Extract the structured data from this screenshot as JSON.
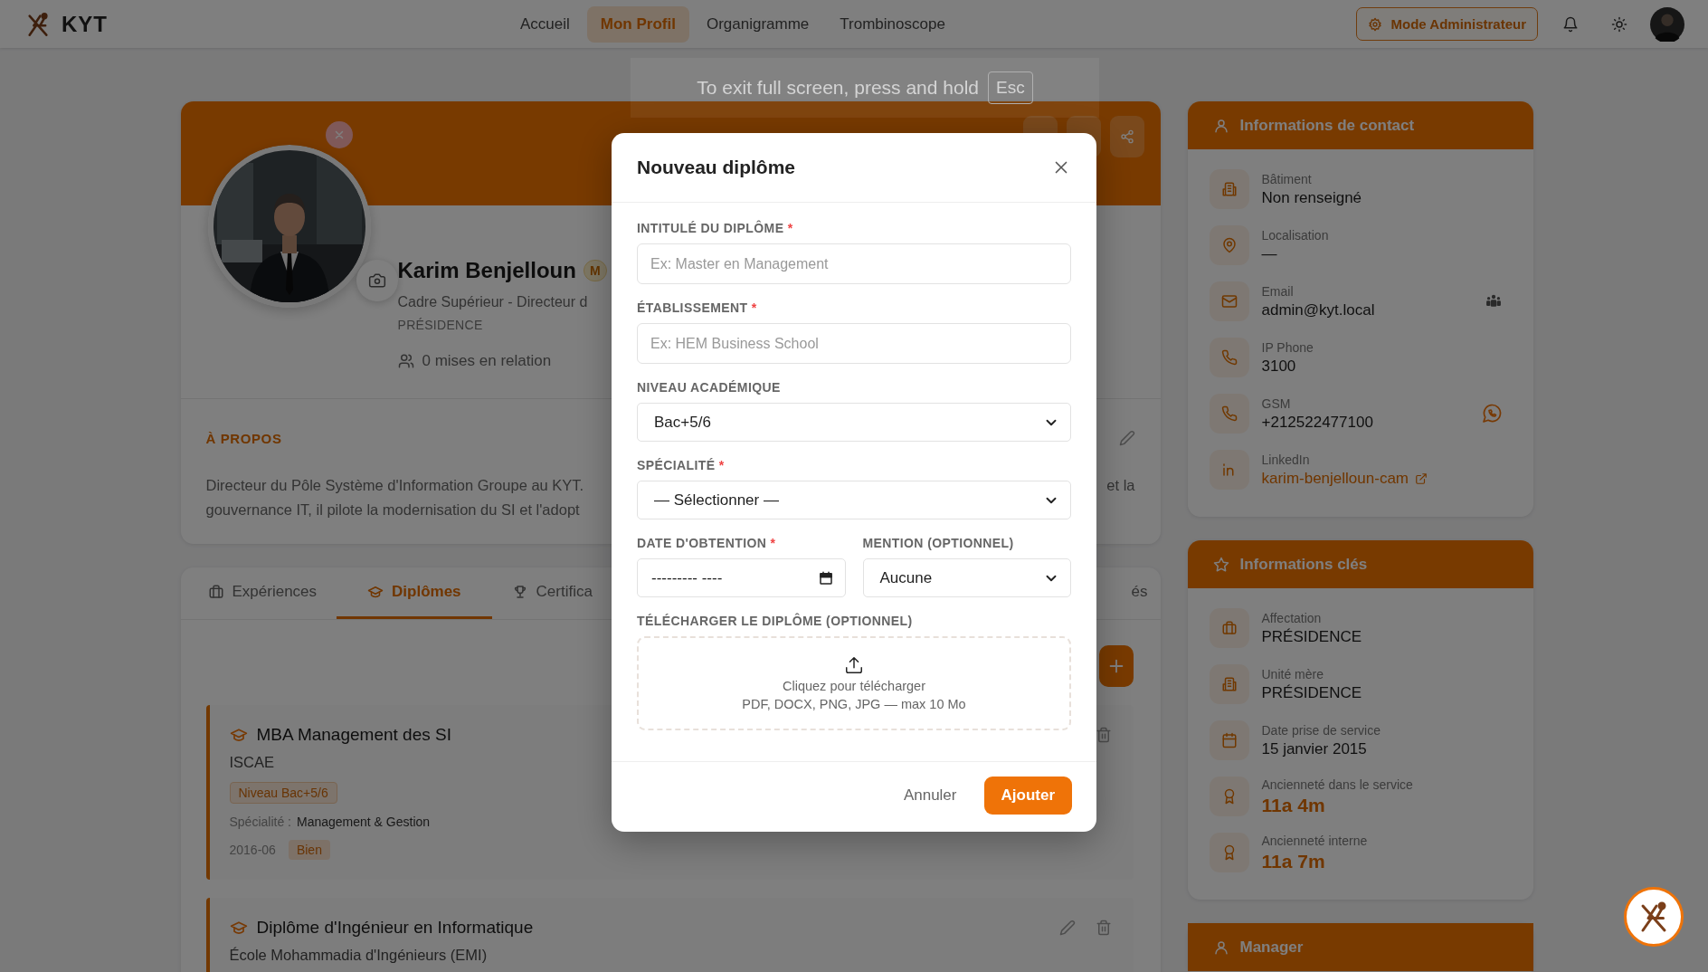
{
  "header": {
    "logo": "KYT",
    "nav": [
      {
        "label": "Accueil",
        "selected": false
      },
      {
        "label": "Mon Profil",
        "selected": true
      },
      {
        "label": "Organigramme",
        "selected": false
      },
      {
        "label": "Trombinoscope",
        "selected": false
      }
    ],
    "admin_button": "Mode Administrateur"
  },
  "fullscreen_notice": {
    "text": "To exit full screen, press and hold",
    "key": "Esc"
  },
  "profile": {
    "name": "Karim Benjelloun",
    "badge": "M",
    "title": "Cadre Supérieur - Directeur d",
    "unit": "PRÉSIDENCE",
    "connections": "0 mises en relation"
  },
  "about": {
    "heading": "À PROPOS",
    "lines": [
      "Directeur du Pôle Système d'Information Groupe au KYT.",
      "gouvernance IT, il pilote la modernisation du SI et l'adopt"
    ],
    "right_fragment": "et la"
  },
  "tabs": [
    {
      "label": "Expériences",
      "kind": "briefcase",
      "selected": false
    },
    {
      "label": "Diplômes",
      "kind": "cap",
      "selected": true
    },
    {
      "label": "Certifica",
      "kind": "trophy",
      "selected": false
    },
    {
      "label": "és",
      "kind": "none",
      "selected": false
    }
  ],
  "diplomas": [
    {
      "title": "MBA Management des SI",
      "school": "ISCAE",
      "level_tag": "Niveau Bac+5/6",
      "specialty_label": "Spécialité :",
      "specialty": "Management & Gestion",
      "date": "2016-06",
      "mention": "Bien"
    },
    {
      "title": "Diplôme d'Ingénieur en Informatique",
      "school": "École Mohammadia d'Ingénieurs (EMI)"
    }
  ],
  "contact": {
    "title": "Informations de contact",
    "rows": [
      {
        "kind": "building",
        "label": "Bâtiment",
        "value": "Non renseigné"
      },
      {
        "kind": "location",
        "label": "Localisation",
        "value": "—"
      },
      {
        "kind": "email",
        "label": "Email",
        "value": "admin@kyt.local"
      },
      {
        "kind": "phone",
        "label": "IP Phone",
        "value": "3100"
      },
      {
        "kind": "gsm",
        "label": "GSM",
        "value": "+212522477100"
      },
      {
        "kind": "linkedin",
        "label": "LinkedIn",
        "value": "karim-benjelloun-cam"
      }
    ]
  },
  "key_info": {
    "title": "Informations clés",
    "rows": [
      {
        "kind": "briefcase",
        "label": "Affectation",
        "value": "PRÉSIDENCE",
        "emphasis": false
      },
      {
        "kind": "building",
        "label": "Unité mère",
        "value": "PRÉSIDENCE",
        "emphasis": false
      },
      {
        "kind": "calendar",
        "label": "Date prise de service",
        "value": "15 janvier 2015",
        "emphasis": false
      },
      {
        "kind": "award",
        "label": "Ancienneté dans le service",
        "value": "11a 4m",
        "emphasis": true
      },
      {
        "kind": "award",
        "label": "Ancienneté interne",
        "value": "11a 7m",
        "emphasis": true
      }
    ]
  },
  "manager": {
    "title": "Manager"
  },
  "modal": {
    "title": "Nouveau diplôme",
    "fields": [
      {
        "kind": "text",
        "label": "INTITULÉ DU DIPLÔME",
        "required_mark": "*",
        "placeholder": "Ex: Master en Management"
      },
      {
        "kind": "text",
        "label": "ÉTABLISSEMENT",
        "required_mark": "*",
        "placeholder": "Ex: HEM Business School"
      },
      {
        "kind": "select",
        "label": "NIVEAU ACADÉMIQUE",
        "value": "Bac+5/6"
      },
      {
        "kind": "select",
        "label": "SPÉCIALITÉ",
        "required_mark": "*",
        "value": "— Sélectionner —"
      }
    ],
    "row": [
      {
        "kind": "date",
        "label": "DATE D'OBTENTION",
        "required_mark": "*",
        "value": "--------- ----"
      },
      {
        "kind": "select",
        "label": "MENTION (OPTIONNEL)",
        "value": "Aucune"
      }
    ],
    "upload": {
      "label": "TÉLÉCHARGER LE DIPLÔME (OPTIONNEL)",
      "text": "Cliquez pour télécharger",
      "hint": "PDF, DOCX, PNG, JPG — max 10 Mo"
    },
    "cancel": "Annuler",
    "submit": "Ajouter"
  }
}
